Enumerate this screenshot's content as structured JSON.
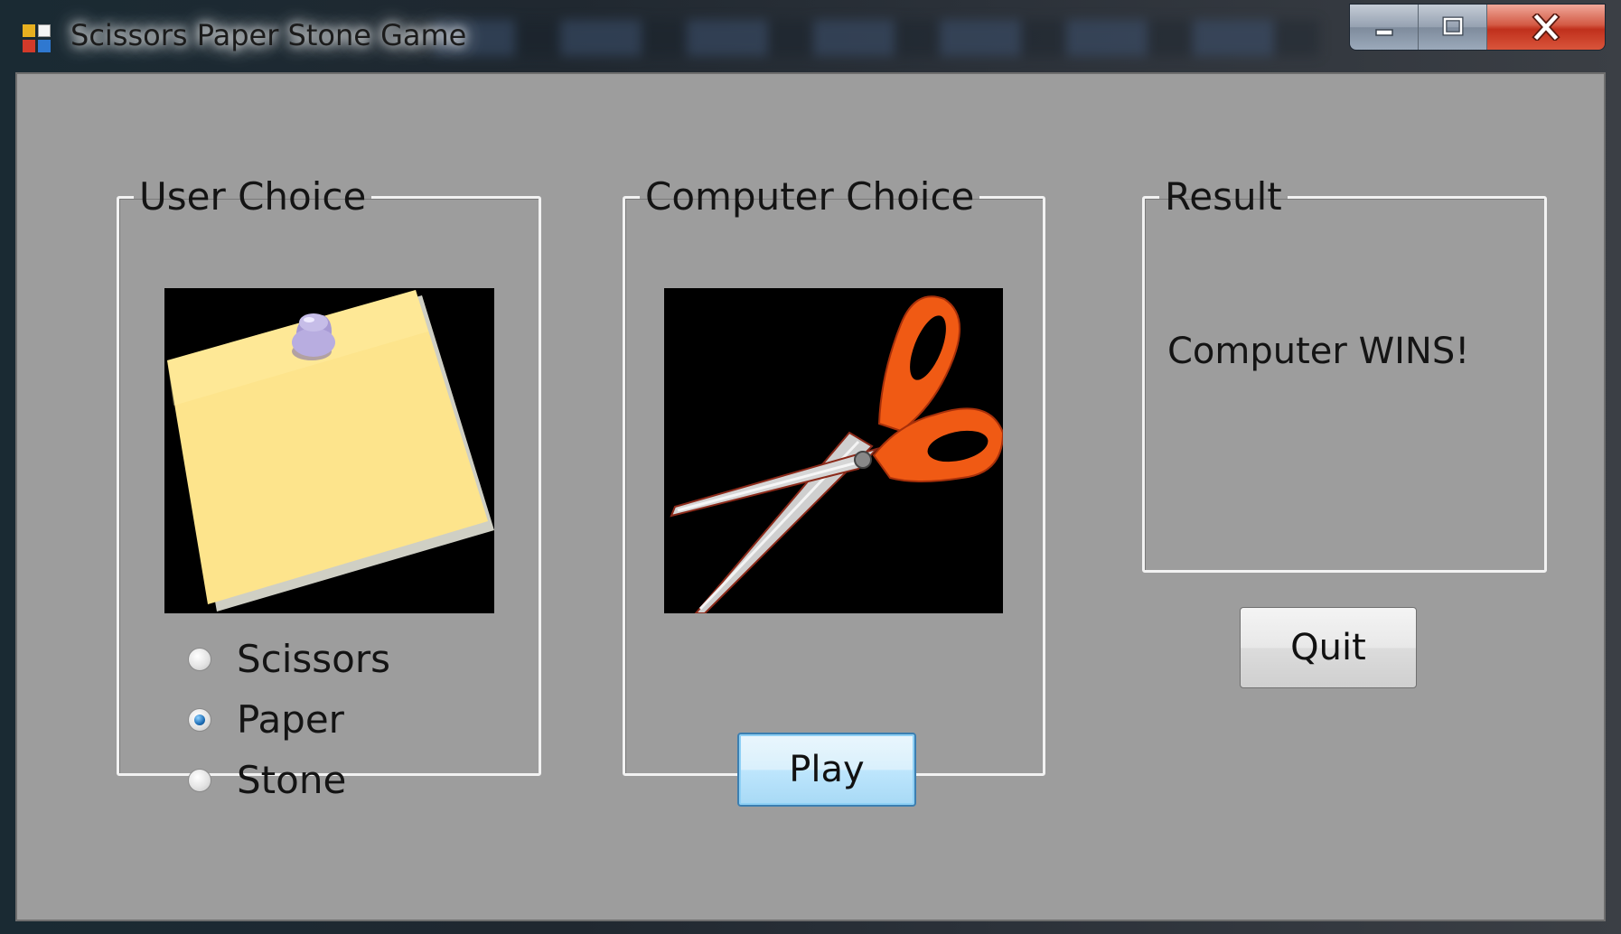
{
  "window": {
    "title": "Scissors Paper Stone Game",
    "controls": {
      "minimize_icon": "minimize-icon",
      "maximize_icon": "maximize-icon",
      "close_icon": "close-icon"
    }
  },
  "user_choice": {
    "legend": "User Choice",
    "image": "sticky-note-with-pushpin",
    "options": [
      {
        "label": "Scissors",
        "checked": false
      },
      {
        "label": "Paper",
        "checked": true
      },
      {
        "label": "Stone",
        "checked": false
      }
    ]
  },
  "computer_choice": {
    "legend": "Computer Choice",
    "image": "orange-handled-scissors",
    "play_label": "Play"
  },
  "result": {
    "legend": "Result",
    "text": "Computer WINS!"
  },
  "quit_label": "Quit",
  "colors": {
    "form_background": "#9d9d9d",
    "group_border": "#f2f2f2",
    "scissors_handle": "#f05a14",
    "sticky_note": "#fde48c",
    "pushpin": "#a79ad4",
    "radio_selected": "#1f6fb8"
  }
}
